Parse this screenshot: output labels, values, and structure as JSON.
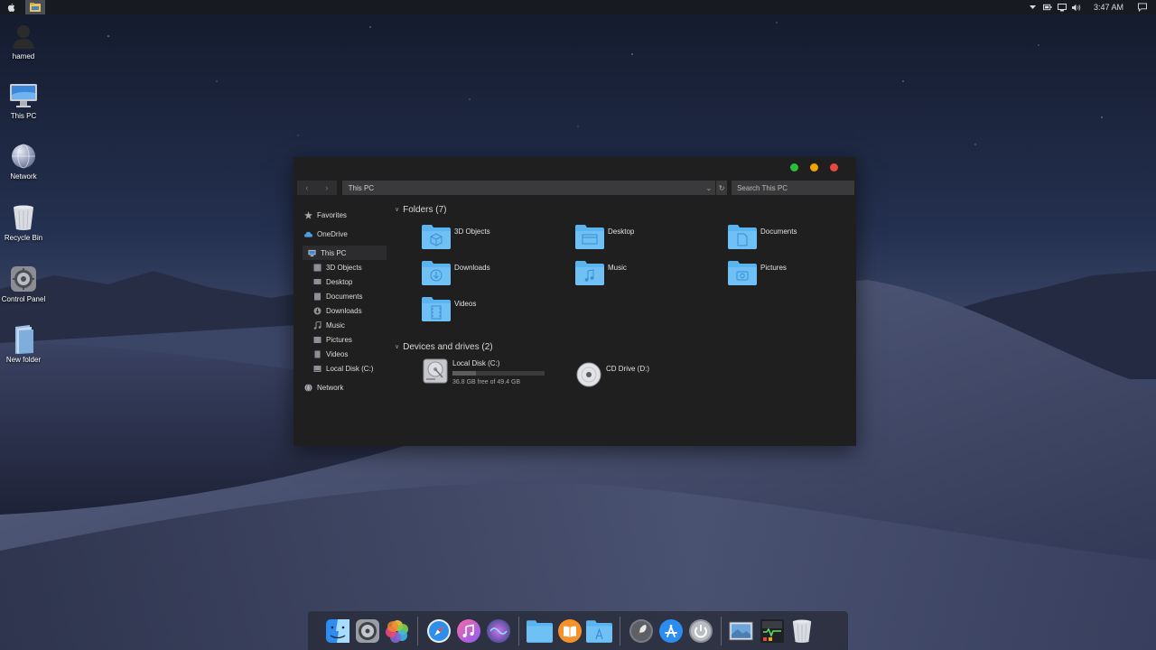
{
  "topbar": {
    "clock": "3:47 AM",
    "icons": [
      "apple-icon",
      "file-explorer-icon",
      "tray-chevron-icon",
      "battery-icon",
      "network-icon",
      "volume-icon",
      "notification-icon"
    ]
  },
  "desktop": {
    "icons": [
      {
        "label": "hamed",
        "icon": "user-icon"
      },
      {
        "label": "This PC",
        "icon": "computer-icon"
      },
      {
        "label": "Network",
        "icon": "network-globe-icon"
      },
      {
        "label": "Recycle Bin",
        "icon": "recycle-bin-icon"
      },
      {
        "label": "Control Panel",
        "icon": "control-panel-icon"
      },
      {
        "label": "New folder",
        "icon": "folder-icon"
      }
    ]
  },
  "window": {
    "address": "This PC",
    "search_placeholder": "Search This PC",
    "controls": {
      "green": "#2bbd3a",
      "yellow": "#f0a500",
      "red": "#e5483f"
    },
    "sidebar": {
      "favorites": "Favorites",
      "onedrive": "OneDrive",
      "this_pc": "This PC",
      "items": [
        "3D Objects",
        "Desktop",
        "Documents",
        "Downloads",
        "Music",
        "Pictures",
        "Videos",
        "Local Disk (C:)"
      ],
      "network": "Network"
    },
    "folders_header": "Folders (7)",
    "folders": [
      "3D Objects",
      "Desktop",
      "Documents",
      "Downloads",
      "Music",
      "Pictures",
      "Videos"
    ],
    "drives_header": "Devices and drives (2)",
    "drives": [
      {
        "name": "Local Disk (C:)",
        "free": "36.8 GB free of 49.4 GB",
        "used_fraction": 0.255
      },
      {
        "name": "CD Drive (D:)"
      }
    ]
  },
  "dock": {
    "apps": [
      "finder-icon",
      "system-preferences-icon",
      "photos-icon",
      "safari-icon",
      "itunes-icon",
      "siri-icon",
      "files-folder-icon",
      "ibooks-icon",
      "applications-folder-icon",
      "launchpad-icon",
      "app-store-icon",
      "power-icon",
      "preview-icon",
      "activity-monitor-icon",
      "trash-icon"
    ]
  },
  "colors": {
    "folder_blue": "#5ab4f0",
    "window_bg": "#1f1f20",
    "topbar_bg": "#171a21"
  }
}
